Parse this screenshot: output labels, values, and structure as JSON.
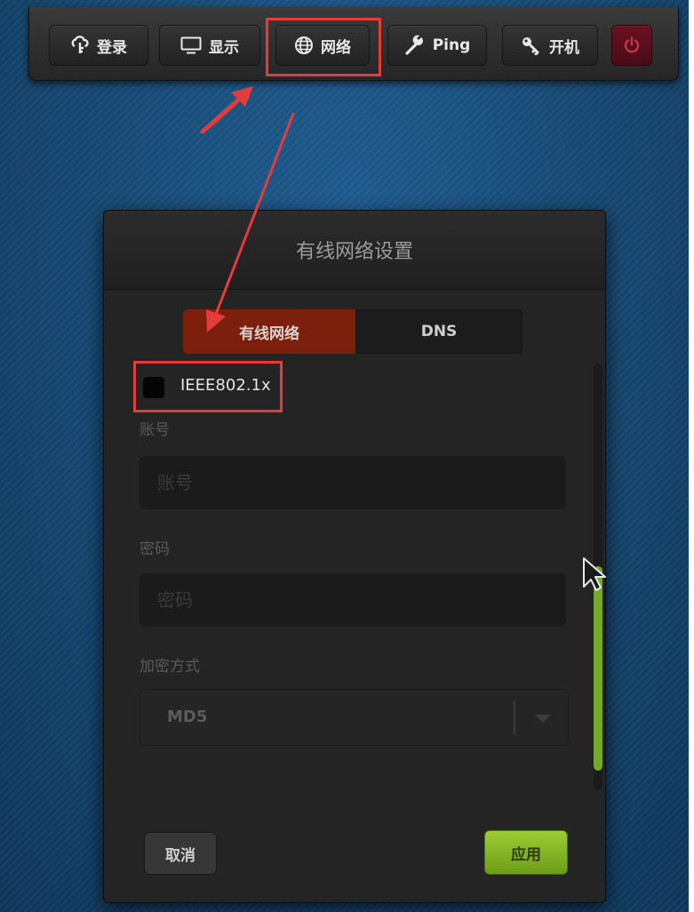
{
  "toolbar": {
    "login_label": "登录",
    "display_label": "显示",
    "network_label": "网络",
    "ping_label": "Ping",
    "power_on_label": "开机",
    "icons": {
      "login": "cloud-key-icon",
      "display": "monitor-icon",
      "network": "globe-icon",
      "ping": "wrench-icon",
      "power_on": "key-icon",
      "power": "power-icon"
    }
  },
  "dialog": {
    "title": "有线网络设置",
    "tabs": [
      {
        "label": "有线网络",
        "active": true
      },
      {
        "label": "DNS",
        "active": false
      }
    ],
    "ieee_checkbox": {
      "label": "IEEE802.1x",
      "checked": false
    },
    "account": {
      "label": "账号",
      "placeholder": "账号",
      "value": ""
    },
    "password": {
      "label": "密码",
      "placeholder": "密码",
      "value": ""
    },
    "encryption": {
      "label": "加密方式",
      "selected": "MD5"
    },
    "cancel_label": "取消",
    "apply_label": "应用"
  },
  "colors": {
    "background": "#1a4b78",
    "active_tab": "#7c1f0c",
    "apply_button": "#8bbf27",
    "scrollbar_thumb": "#75a92a",
    "power_button": "#5a0e1a",
    "annotation": "#e53b3b"
  }
}
